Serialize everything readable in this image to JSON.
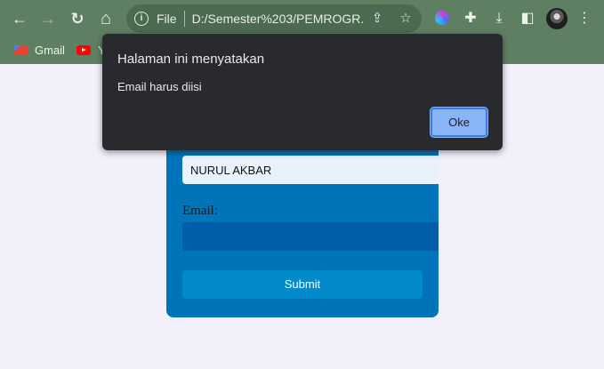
{
  "browser": {
    "nav": {
      "back_icon": "←",
      "forward_icon": "→",
      "reload_icon": "↻",
      "home_icon": "⌂"
    },
    "omnibox": {
      "scheme_label": "File",
      "url": "D:/Semester%203/PEMROGR..."
    },
    "bookmarks": [
      {
        "label": "Gmail"
      },
      {
        "label": "Y"
      }
    ]
  },
  "form": {
    "name_value": "NURUL AKBAR",
    "email_label": "Email:",
    "email_value": "",
    "submit_label": "Submit"
  },
  "dialog": {
    "title": "Halaman ini menyatakan",
    "message": "Email harus diisi",
    "ok_label": "Oke"
  },
  "colors": {
    "chrome": "#5f7f62",
    "card": "#0074b8",
    "dialog_bg": "#292a2d",
    "ok_button": "#8ab4f8"
  }
}
